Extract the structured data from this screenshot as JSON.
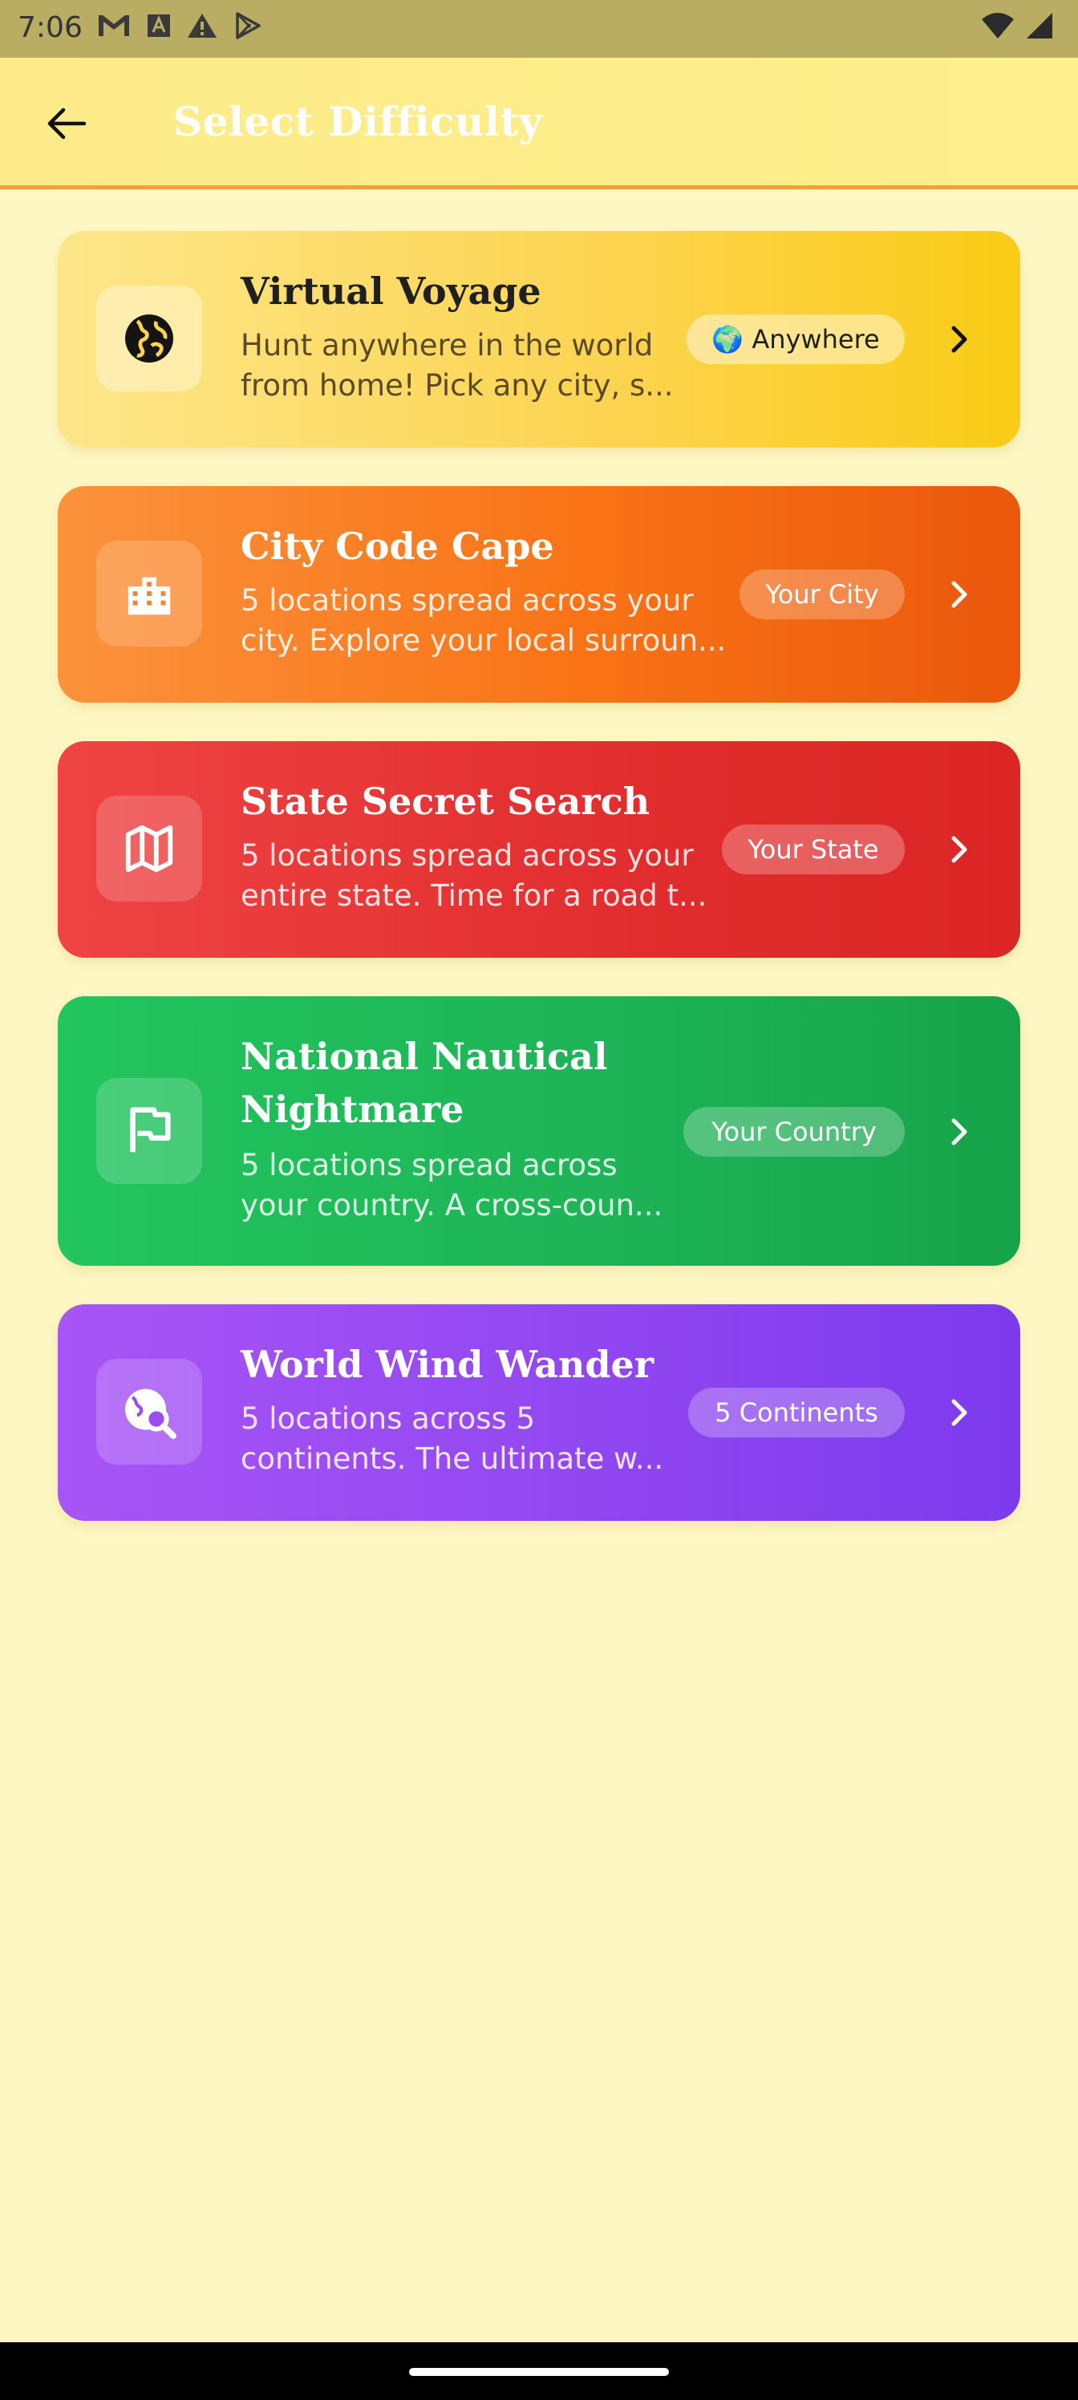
{
  "status_bar": {
    "time": "7:06",
    "left_icons": [
      "gmail-icon",
      "font-a-icon",
      "warning-icon",
      "play-store-icon"
    ],
    "right_icons": [
      "wifi-icon",
      "signal-icon"
    ]
  },
  "app_bar": {
    "title": "Select Difficulty",
    "back_icon": "arrow-back-icon"
  },
  "cards": [
    {
      "title": "Virtual Voyage",
      "desc_line1": "Hunt anywhere in the world",
      "desc_line2": "from home! Pick any city, s...",
      "badge": "🌍 Anywhere",
      "icon": "globe-icon",
      "color": "#facc15"
    },
    {
      "title": "City Code Cape",
      "desc_line1": "5 locations spread across your",
      "desc_line2": "city. Explore your local surroun...",
      "badge": "Your City",
      "icon": "building-icon",
      "color": "#f97316"
    },
    {
      "title": "State Secret Search",
      "desc_line1": "5 locations spread across your",
      "desc_line2": "entire state. Time for a road t...",
      "badge": "Your State",
      "icon": "map-icon",
      "color": "#ef4444"
    },
    {
      "title_line1": "National Nautical",
      "title_line2": "Nightmare",
      "desc_line1": "5 locations spread across",
      "desc_line2": "your country. A cross-coun...",
      "badge": "Your Country",
      "icon": "flag-icon",
      "color": "#22c55e"
    },
    {
      "title": "World Wind Wander",
      "desc_line1": "5 locations across 5",
      "desc_line2": "continents. The ultimate w...",
      "badge": "5 Continents",
      "icon": "travel-explore-icon",
      "color": "#a855f7"
    }
  ]
}
